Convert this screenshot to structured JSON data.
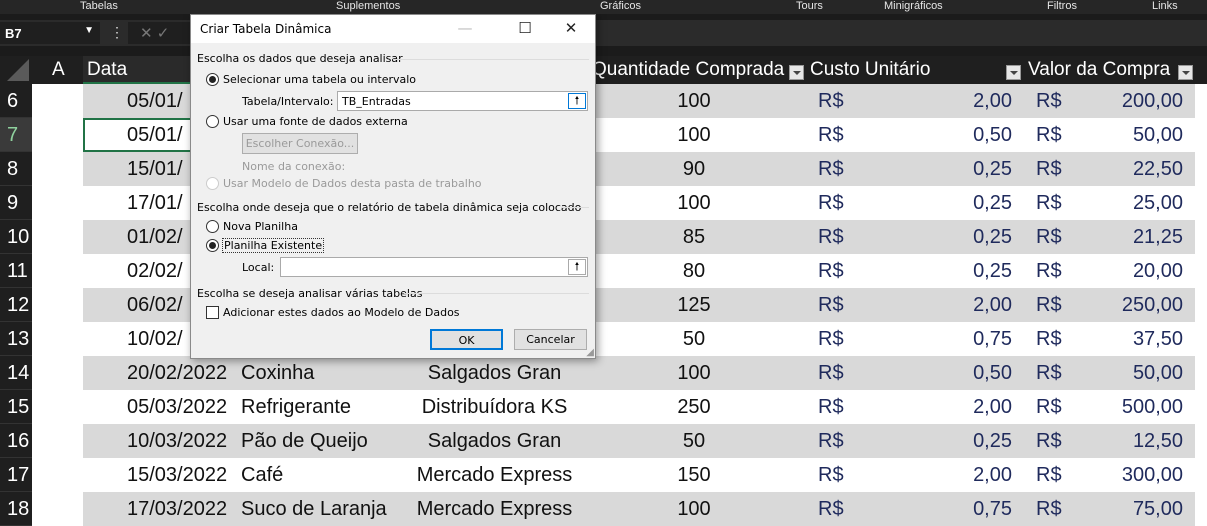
{
  "ribbon": {
    "groups": [
      "Tabelas",
      "Suplementos",
      "Gráficos",
      "Tours",
      "Minigráficos",
      "Filtros",
      "Links"
    ]
  },
  "formula_bar": {
    "name_box": "B7",
    "cancel_icon": "✕",
    "enter_icon": "✓"
  },
  "columns": {
    "a": "A",
    "data": "Data",
    "quantidade": "Quantidade Comprada",
    "custo": "Custo Unitário",
    "valor": "Valor da Compra"
  },
  "currency": "R$",
  "rows": [
    {
      "n": "6",
      "date": "05/01/",
      "product": "",
      "supplier": "",
      "qty": "100",
      "cost": "2,00",
      "total": "200,00"
    },
    {
      "n": "7",
      "date": "05/01/",
      "product": "",
      "supplier": "",
      "qty": "100",
      "cost": "0,50",
      "total": "50,00"
    },
    {
      "n": "8",
      "date": "15/01/",
      "product": "",
      "supplier": "",
      "qty": "90",
      "cost": "0,25",
      "total": "22,50"
    },
    {
      "n": "9",
      "date": "17/01/",
      "product": "",
      "supplier": "",
      "qty": "100",
      "cost": "0,25",
      "total": "25,00"
    },
    {
      "n": "10",
      "date": "01/02/",
      "product": "",
      "supplier": "",
      "qty": "85",
      "cost": "0,25",
      "total": "21,25"
    },
    {
      "n": "11",
      "date": "02/02/",
      "product": "",
      "supplier": "",
      "qty": "80",
      "cost": "0,25",
      "total": "20,00"
    },
    {
      "n": "12",
      "date": "06/02/",
      "product": "",
      "supplier": "",
      "qty": "125",
      "cost": "2,00",
      "total": "250,00"
    },
    {
      "n": "13",
      "date": "10/02/",
      "product": "",
      "supplier": "",
      "qty": "50",
      "cost": "0,75",
      "total": "37,50"
    },
    {
      "n": "14",
      "date": "20/02/2022",
      "product": "Coxinha",
      "supplier": "Salgados Gran",
      "qty": "100",
      "cost": "0,50",
      "total": "50,00"
    },
    {
      "n": "15",
      "date": "05/03/2022",
      "product": "Refrigerante",
      "supplier": "Distribuídora KS",
      "qty": "250",
      "cost": "2,00",
      "total": "500,00"
    },
    {
      "n": "16",
      "date": "10/03/2022",
      "product": "Pão de Queijo",
      "supplier": "Salgados Gran",
      "qty": "50",
      "cost": "0,25",
      "total": "12,50"
    },
    {
      "n": "17",
      "date": "15/03/2022",
      "product": "Café",
      "supplier": "Mercado Express",
      "qty": "150",
      "cost": "2,00",
      "total": "300,00"
    },
    {
      "n": "18",
      "date": "17/03/2022",
      "product": "Suco de Laranja",
      "supplier": "Mercado Express",
      "qty": "100",
      "cost": "0,75",
      "total": "75,00"
    }
  ],
  "dialog": {
    "title": "Criar Tabela Dinâmica",
    "section1": "Escolha os dados que deseja analisar",
    "opt_table": "Selecionar uma tabela ou intervalo",
    "table_label": "Tabela/Intervalo:",
    "table_value": "TB_Entradas",
    "opt_external": "Usar uma fonte de dados externa",
    "choose_conn": "Escolher Conexão...",
    "conn_name": "Nome da conexão:",
    "opt_model": "Usar Modelo de Dados desta pasta de trabalho",
    "section2": "Escolha onde deseja que o relatório de tabela dinâmica seja colocado",
    "opt_new": "Nova Planilha",
    "opt_existing": "Planilha Existente",
    "local_label": "Local:",
    "local_value": "",
    "section3": "Escolha se deseja analisar várias tabelas",
    "add_model": "Adicionar estes dados ao Modelo de Dados",
    "ok": "OK",
    "cancel": "Cancelar",
    "selected_source": "table",
    "selected_location": "existing",
    "add_model_checked": false
  }
}
